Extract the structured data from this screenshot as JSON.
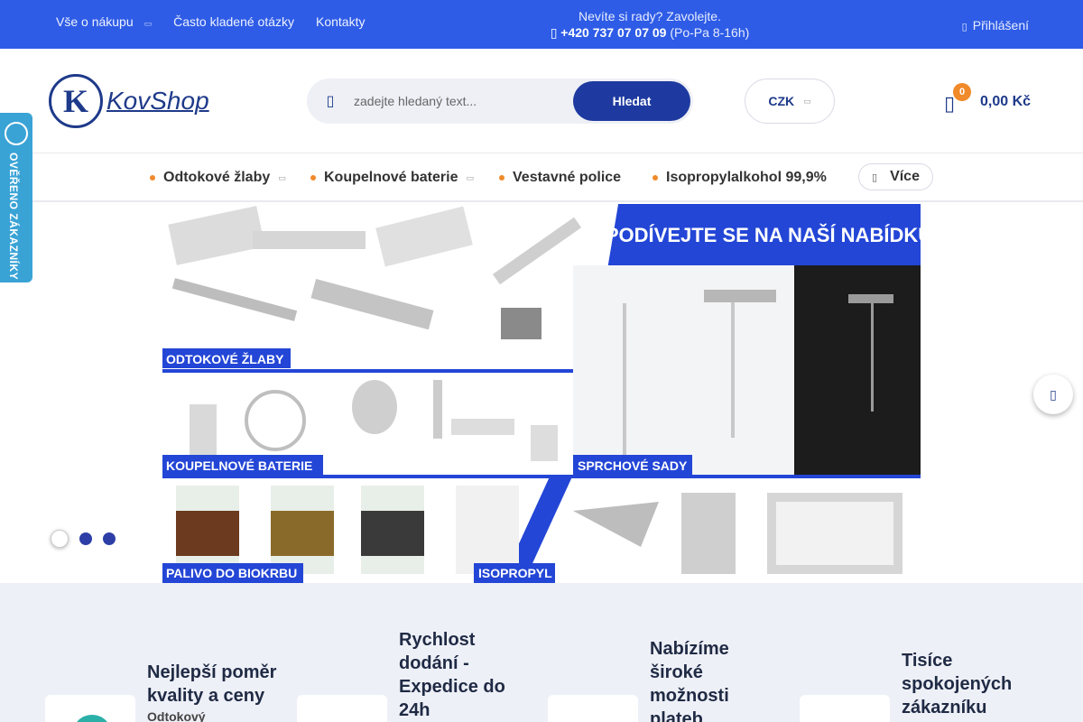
{
  "topbar": {
    "nav": [
      {
        "label": "Vše o nákupu",
        "has_dropdown": true
      },
      {
        "label": "Často kladené otázky",
        "has_dropdown": false
      },
      {
        "label": "Kontakty",
        "has_dropdown": false
      }
    ],
    "help_question": "Nevíte si rady? Zavolejte.",
    "phone": "+420 737 07 07 09",
    "hours": "(Po-Pa 8-16h)",
    "login_label": "Přihlášení"
  },
  "header": {
    "logo_letter": "K",
    "logo_text": "KovShop",
    "search_placeholder": "zadejte hledaný text...",
    "search_button": "Hledat",
    "currency": "CZK",
    "cart_count": "0",
    "cart_total": "0,00 Kč"
  },
  "menu": {
    "items": [
      {
        "label": "Odtokové žlaby",
        "has_dropdown": true
      },
      {
        "label": "Koupelnové baterie",
        "has_dropdown": true
      },
      {
        "label": "Vestavné police",
        "has_dropdown": false
      },
      {
        "label": "Isopropylalkohol 99,9%",
        "has_dropdown": false
      }
    ],
    "more_label": "Více"
  },
  "side_badge": {
    "label": "OVĚŘENO ZÁKAZNÍKY",
    "seal_text": "ověřeno zákazníky"
  },
  "banner": {
    "headline": "PODÍVEJTE SE NA NAŠÍ NABÍDKU",
    "labels": [
      "ODTOKOVÉ ŽLABY",
      "KOUPELNOVÉ BATERIE",
      "SPRCHOVÉ SADY",
      "PALIVO DO BIOKRBU",
      "ISOPROPYL"
    ],
    "slide_count": 3,
    "active_slide": 1
  },
  "benefits": [
    {
      "title": "Nejlepší poměr kvality a ceny",
      "subtitle": "Odtokový žlaby z"
    },
    {
      "title": "Rychlost dodání - Expedice do 24h",
      "subtitle": ""
    },
    {
      "title": "Nabízíme široké možnosti plateb",
      "subtitle": ""
    },
    {
      "title": "Tisíce spokojených zákazníku",
      "subtitle": ""
    }
  ],
  "colors": {
    "topbar": "#2e5ce6",
    "brand": "#1e3a8a",
    "accent": "#f08a2a",
    "banner_blue": "#2346d6",
    "badge": "#3aa3d6"
  }
}
